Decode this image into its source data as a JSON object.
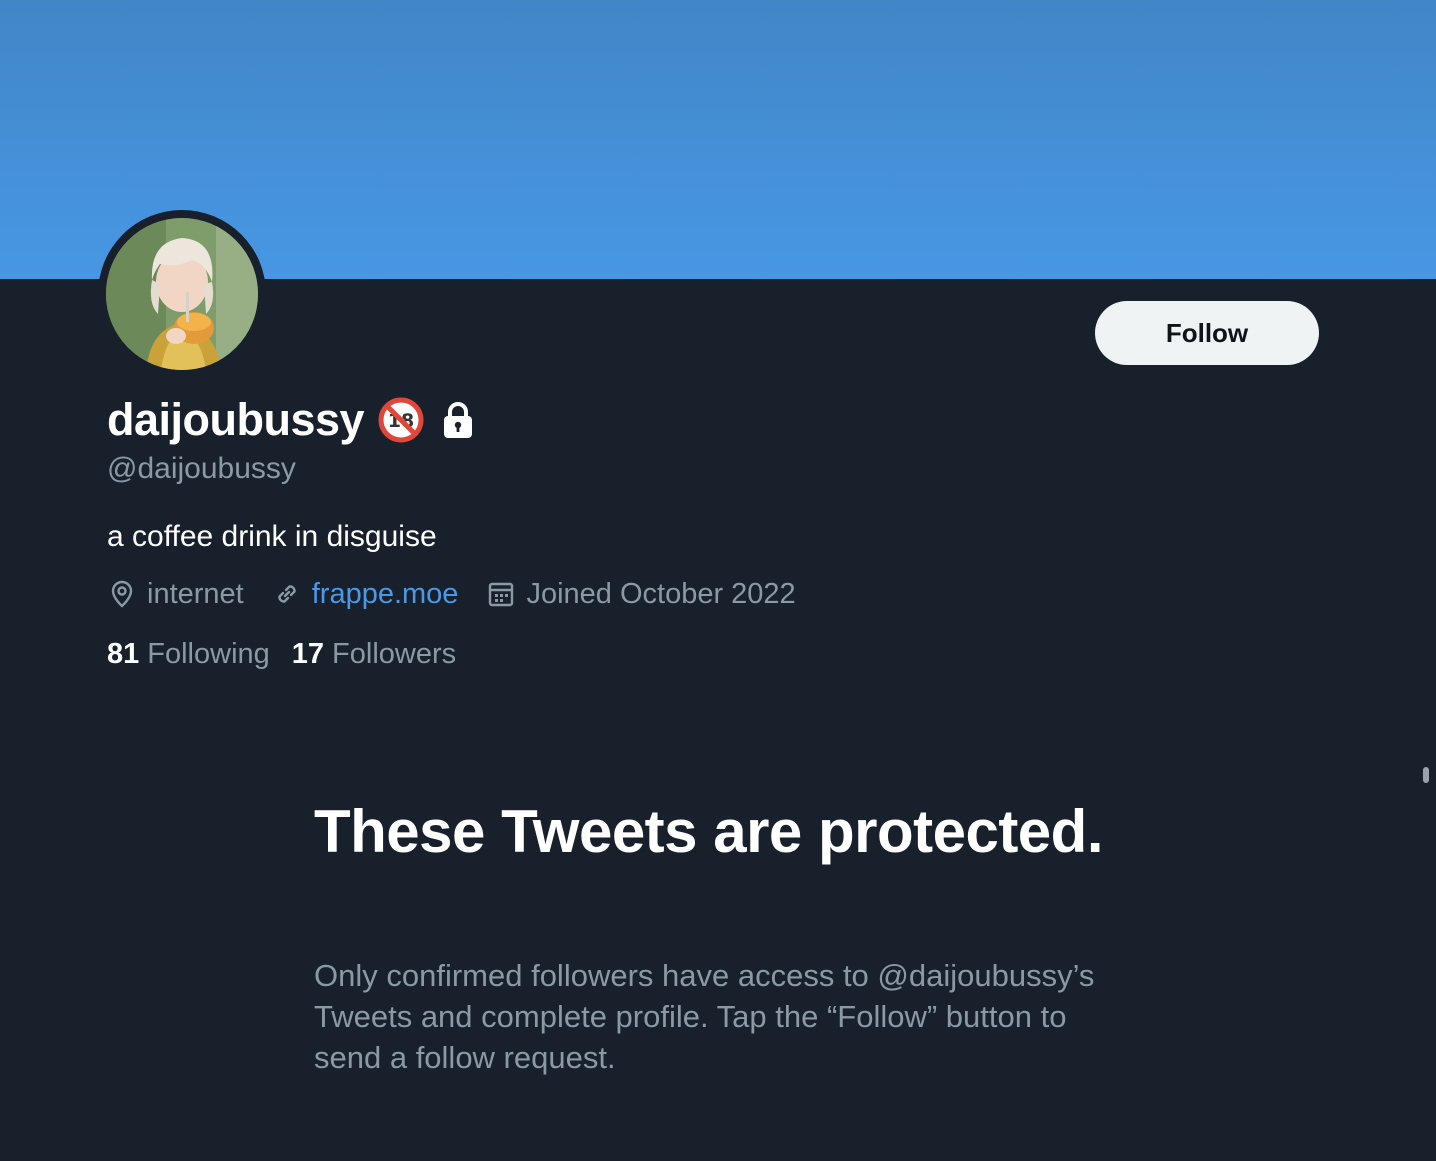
{
  "profile": {
    "display_name": "daijoubussy",
    "handle": "@daijoubussy",
    "bio": "a coffee drink in disguise",
    "location": "internet",
    "website": "frappe.moe",
    "joined": "Joined October 2022",
    "following_count": "81",
    "following_label": "Following",
    "followers_count": "17",
    "followers_label": "Followers",
    "badges": [
      "no-under-18-icon",
      "lock-icon"
    ]
  },
  "actions": {
    "follow_label": "Follow"
  },
  "protected_notice": {
    "title": "These Tweets are protected.",
    "body": "Only confirmed followers have access to @daijoubussy’s Tweets and complete profile. Tap the “Follow” button to send a follow request."
  },
  "colors": {
    "banner_top": "#4186c7",
    "banner_bottom": "#4897e4",
    "background": "#18202c",
    "link": "#4a99e9",
    "secondary_text": "#8b98a5",
    "button_bg": "#eff3f4"
  }
}
